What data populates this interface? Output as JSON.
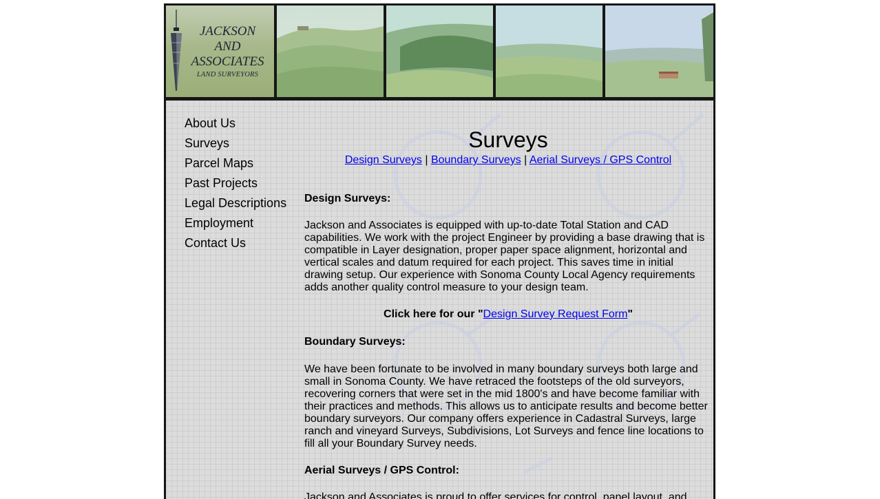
{
  "logo": {
    "line1": "JACKSON",
    "line2": "AND",
    "line3": "ASSOCIATES",
    "line4": "LAND SURVEYORS"
  },
  "nav": {
    "items": [
      {
        "label": "About Us"
      },
      {
        "label": "Surveys"
      },
      {
        "label": "Parcel Maps"
      },
      {
        "label": "Past Projects"
      },
      {
        "label": "Legal Descriptions"
      },
      {
        "label": "Employment"
      },
      {
        "label": "Contact Us"
      }
    ]
  },
  "main": {
    "title": "Surveys",
    "subnav": {
      "design": "Design Surveys",
      "boundary": "Boundary Surveys",
      "aerial": "Aerial Surveys / GPS Control",
      "separator": "|"
    },
    "design": {
      "heading": "Design Surveys:",
      "body": "Jackson and Associates is equipped with up-to-date Total Station and CAD capabilities. We work with the project Engineer by providing a base drawing that is compatible in Layer designation, proper paper space alignment, horizontal and vertical scales and datum required for each project. This saves time in initial drawing setup. Our experience with Sonoma County Local Agency requirements adds another quality control measure to your design team."
    },
    "cta": {
      "prefix": "Click here for our \"",
      "link": "Design Survey Request Form",
      "suffix": "\""
    },
    "boundary": {
      "heading": "Boundary Surveys:",
      "body": "We have been fortunate to be involved in many boundary surveys both large and small in Sonoma County. We have retraced the footsteps of the old surveyors, recovering corners that were set in the mid 1800's and have become familiar with their practices and methods. This allows us to anticipate results and become better boundary surveyors. Our company offers experience in Cadastral Surveys, large ranch and vineyard Surveys, Subdivisions, Lot Surveys and fence line locations to fill all your Boundary Survey needs."
    },
    "aerial": {
      "heading": "Aerial Surveys / GPS Control:",
      "body": "Jackson and Associates is proud to offer services for control, panel layout, and"
    }
  },
  "colors": {
    "link": "#0000ee",
    "frame": "#161616",
    "content_bg": "#dcdcdc"
  }
}
